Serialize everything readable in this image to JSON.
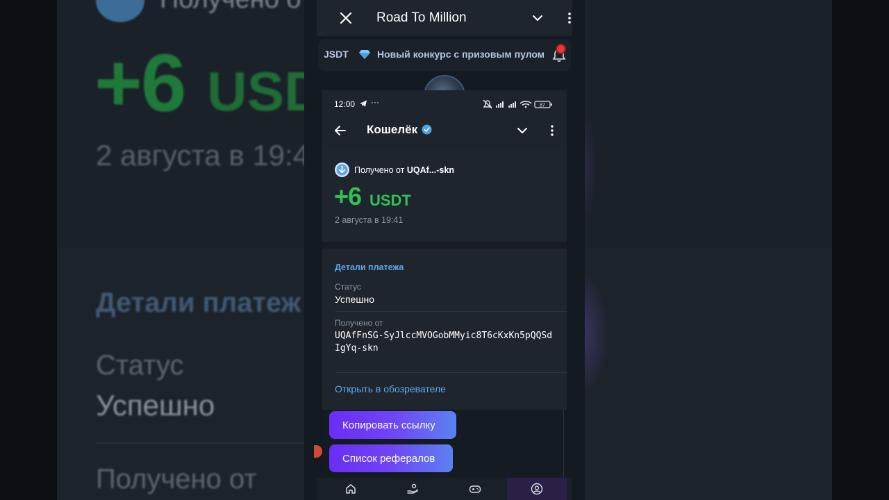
{
  "backdrop": {
    "received_prefix": "Получено от",
    "amount": "+6",
    "currency": "USD",
    "date": "2 августа в 19:4",
    "details_title": "Детали платеж",
    "status_label": "Статус",
    "status_value": "Успешно",
    "from_label": "Получено от"
  },
  "miniapp": {
    "title": "Road To Million",
    "ticker_prefix": "JSDT",
    "ticker_text": "Новый конкурс с призовым пулом"
  },
  "status_bar": {
    "time": "12:00",
    "dots": "···",
    "battery": "87"
  },
  "wallet": {
    "title": "Кошелёк",
    "tx": {
      "received_from_label": "Получено от",
      "sender_short": "UQAf...-skn",
      "amount": "+6",
      "currency": "USDT",
      "date": "2 августа в 19:41"
    },
    "details": {
      "title": "Детали платежа",
      "status_label": "Статус",
      "status_value": "Успешно",
      "from_label": "Получено от",
      "from_address": "UQAfFnSG-SyJlccMVOGobMMyic8T6cKxKn5pQQSdIgYq-skn",
      "explorer_link": "Открыть в обозревателе"
    }
  },
  "actions": {
    "copy_link": "Копировать ссылку",
    "referrals": "Список рефералов"
  },
  "nav": {
    "items": [
      "home-icon",
      "hand-coin-icon",
      "gamepad-icon",
      "profile-icon"
    ],
    "active_index": 3
  },
  "colors": {
    "accent_green": "#31c057",
    "link_blue": "#5fa8ea",
    "button_gradient_start": "#6a2df7",
    "button_gradient_end": "#5b82f0",
    "notification_red": "#e53935"
  }
}
